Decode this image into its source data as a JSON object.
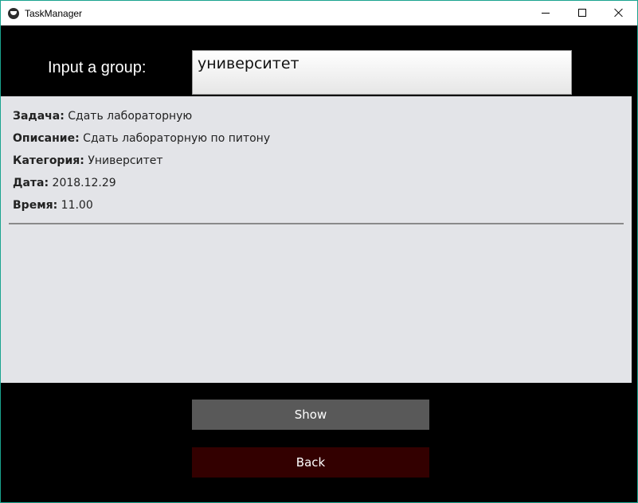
{
  "window": {
    "title": "TaskManager"
  },
  "group": {
    "label": "Input a group:",
    "value": "университет"
  },
  "task": {
    "fields": [
      {
        "label": "Задача:",
        "value": "Сдать лабораторную"
      },
      {
        "label": "Описание:",
        "value": "Сдать лабораторную по питону"
      },
      {
        "label": "Категория:",
        "value": "Университет"
      },
      {
        "label": "Дата:",
        "value": "2018.12.29"
      },
      {
        "label": "Время:",
        "value": "11.00"
      }
    ]
  },
  "buttons": {
    "show_label": "Show",
    "back_label": "Back"
  },
  "colors": {
    "background": "#000000",
    "panel": "#e3e4e8",
    "show_button": "#595959",
    "back_button": "#330000",
    "window_border": "#1aa38f"
  },
  "icons": {
    "app": "app-logo-icon",
    "minimize": "minimize-icon",
    "maximize": "maximize-icon",
    "close": "close-icon"
  }
}
